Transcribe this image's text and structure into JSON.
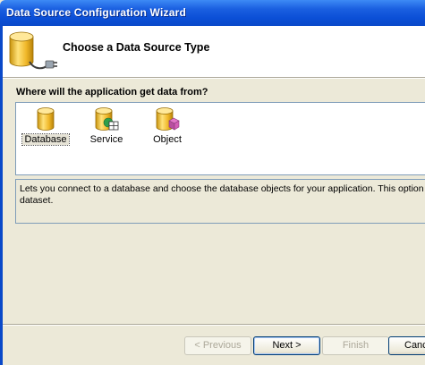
{
  "window": {
    "title": "Data Source Configuration Wizard"
  },
  "header": {
    "title": "Choose a Data Source Type",
    "icon": "database-plug-icon"
  },
  "prompt": "Where will the application get data from?",
  "sources": [
    {
      "label": "Database",
      "icon": "database-icon",
      "selected": true
    },
    {
      "label": "Service",
      "icon": "service-icon",
      "selected": false
    },
    {
      "label": "Object",
      "icon": "object-icon",
      "selected": false
    }
  ],
  "description": {
    "line1": "Lets you connect to a database and choose the database objects for your application. This option create",
    "line2": "dataset."
  },
  "buttons": {
    "previous": "< Previous",
    "next": "Next >",
    "finish": "Finish",
    "cancel": "Cancel"
  },
  "colors": {
    "titlebar": "#0a49c9",
    "dialog_bg": "#ece9d8",
    "border": "#7f9db9",
    "cylinder_gold": "#e8b820"
  }
}
